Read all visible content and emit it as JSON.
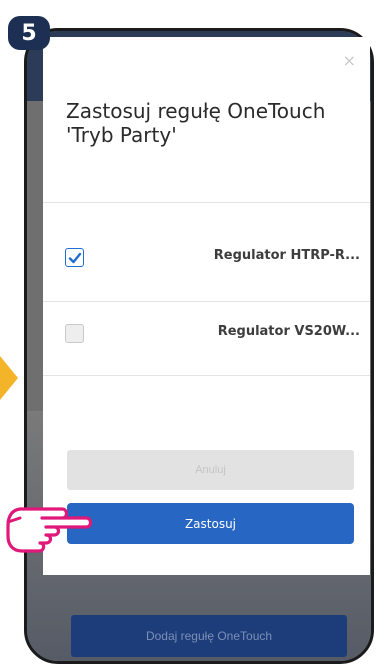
{
  "step": {
    "number": "5"
  },
  "modal": {
    "close_glyph": "×",
    "title": "Zastosuj regułę OneTouch 'Tryb Party'",
    "devices": [
      {
        "label": "Regulator HTRP-R...",
        "checked": true
      },
      {
        "label": "Regulator VS20W...",
        "checked": false
      }
    ],
    "cancel_label": "Anuluj",
    "apply_label": "Zastosuj"
  },
  "background": {
    "add_rule_label": "Dodaj regułę OneTouch"
  },
  "colors": {
    "accent": "#2766c2",
    "badge": "#1d2f52",
    "arrow": "#f4b42a",
    "hand": "#e0187a"
  },
  "icons": [
    "close-icon",
    "checkmark-icon",
    "pointing-hand-icon"
  ]
}
